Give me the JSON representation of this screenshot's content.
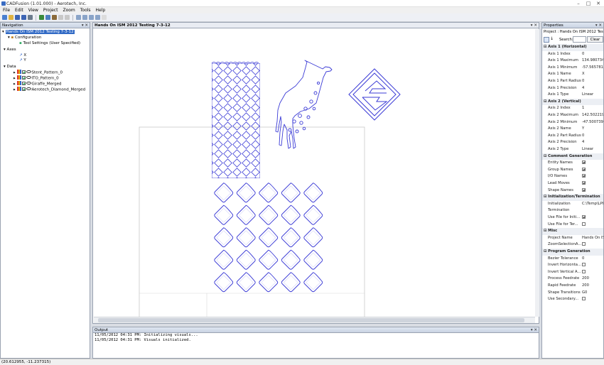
{
  "window": {
    "title": "CADFusion (1.01.000) - Aerotech, Inc.",
    "controls": [
      "–",
      "□",
      "✕"
    ]
  },
  "menu": [
    "File",
    "Edit",
    "View",
    "Project",
    "Zoom",
    "Tools",
    "Help"
  ],
  "toolbar": {
    "icons": [
      "new-icon",
      "open-icon",
      "save-icon",
      "save-all-icon",
      "print-icon",
      "cut-icon",
      "copy-icon",
      "paste-icon",
      "undo-icon",
      "redo-icon",
      "zoom-icon",
      "zoom-in-icon",
      "zoom-out-icon",
      "zoom-fit-icon",
      "pointer-icon"
    ]
  },
  "navigation": {
    "title": "Navigation",
    "controls": "▾ ✕",
    "project": "Hands On ISM 2012 Testing 7-3-12",
    "configuration": "Configuration",
    "tool_settings": "Tool Settings (User Specified)",
    "axes_label": "Axes",
    "axis_x": "X",
    "axis_y": "Y",
    "data_label": "Data",
    "data_items": [
      "Stent_Pattern_0",
      "ITO_Pattern_0",
      "Giraffe_Merged",
      "Aerotech_Diamond_Merged"
    ]
  },
  "document": {
    "tab": "Hands On ISM 2012 Testing 7-3-12",
    "controls": "▾ ✕"
  },
  "output": {
    "title": "Output",
    "controls": "▾ ✕",
    "lines": [
      "11/05/2012 04:31 PM: Initializing visuals...",
      "11/05/2012 04:31 PM: Visuals initialized."
    ]
  },
  "properties": {
    "title": "Properties",
    "controls": "▾ ✕",
    "subtitle": "Project : Hands On ISM 2012 Test...",
    "search_label": "Search:",
    "clear_label": "Clear",
    "rows": [
      {
        "cat": true,
        "k": "Axis 1 (Horizontal)"
      },
      {
        "k": "Axis 1 Index",
        "v": "0"
      },
      {
        "k": "Axis 1 Maximum",
        "v": "134.9807341"
      },
      {
        "k": "Axis 1 Minimum",
        "v": "-57.5657814"
      },
      {
        "k": "Axis 1 Name",
        "v": "X"
      },
      {
        "k": "Axis 1 Part Radius",
        "v": "0"
      },
      {
        "k": "Axis 1 Precision",
        "v": "4"
      },
      {
        "k": "Axis 1 Type",
        "v": "Linear"
      },
      {
        "cat": true,
        "k": "Axis 2 (Vertical)"
      },
      {
        "k": "Axis 2 Index",
        "v": "1"
      },
      {
        "k": "Axis 2 Maximum",
        "v": "142.5022199"
      },
      {
        "k": "Axis 2 Minimum",
        "v": "-47.5007399"
      },
      {
        "k": "Axis 2 Name",
        "v": "Y"
      },
      {
        "k": "Axis 2 Part Radius",
        "v": "0"
      },
      {
        "k": "Axis 2 Precision",
        "v": "4"
      },
      {
        "k": "Axis 2 Type",
        "v": "Linear"
      },
      {
        "cat": true,
        "k": "Comment Generation"
      },
      {
        "k": "Entity Names",
        "cb": true
      },
      {
        "k": "Group Names",
        "cb": true
      },
      {
        "k": "I/O Names",
        "cb": true
      },
      {
        "k": "Lead Moves",
        "cb": true
      },
      {
        "k": "Shape Names",
        "cb": true
      },
      {
        "cat": true,
        "k": "Initialization/Termination"
      },
      {
        "k": "Initialization",
        "v": "C:\\Temp\\LPI"
      },
      {
        "k": "Termination",
        "v": ""
      },
      {
        "k": "Use File for Initi...",
        "cb": true
      },
      {
        "k": "Use File for Ter...",
        "cb": false
      },
      {
        "cat": true,
        "k": "Misc"
      },
      {
        "k": "Project Name",
        "v": "Hands On IS"
      },
      {
        "k": "ZoomSelectionA...",
        "cb": false
      },
      {
        "cat": true,
        "k": "Program Generation"
      },
      {
        "k": "Bezier Tolerance",
        "v": "0"
      },
      {
        "k": "Invert Horizonta...",
        "cb": false
      },
      {
        "k": "Invert Vertical A...",
        "cb": false
      },
      {
        "k": "Process Feedrate",
        "v": "200"
      },
      {
        "k": "Rapid Feedrate",
        "v": "200"
      },
      {
        "k": "Shape Transitions",
        "v": "G0"
      },
      {
        "k": "Use Secondary...",
        "cb": false
      }
    ]
  },
  "status": {
    "coords": "(20.612955, -11.237315)"
  },
  "colors": {
    "accent": "#316ac5",
    "geometry": "#3b3bd6"
  }
}
